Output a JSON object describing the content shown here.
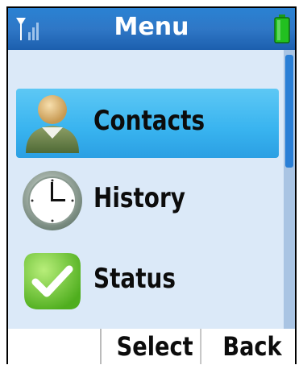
{
  "header": {
    "title": "Menu",
    "signal_icon": "signal-strength-icon",
    "battery_icon": "battery-icon",
    "battery_color": "#22c020"
  },
  "menu": {
    "items": [
      {
        "label": "Contacts",
        "icon": "contacts-icon",
        "selected": true
      },
      {
        "label": "History",
        "icon": "clock-icon",
        "selected": false
      },
      {
        "label": "Status",
        "icon": "checkmark-icon",
        "selected": false
      }
    ]
  },
  "softkeys": {
    "left": "",
    "select": "Select",
    "back": "Back"
  },
  "colors": {
    "accent": "#2f77c6",
    "selected_bg": "#38b3ef",
    "list_bg": "#dbe9f8"
  }
}
